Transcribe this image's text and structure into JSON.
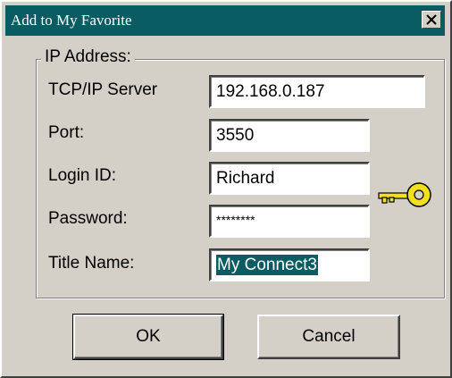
{
  "window": {
    "title": "Add to My Favorite",
    "close_glyph": "×",
    "titlebar_color": "#0a5c63"
  },
  "group": {
    "legend": "IP Address:"
  },
  "fields": {
    "server": {
      "label": "TCP/IP Server",
      "value": "192.168.0.187"
    },
    "port": {
      "label": "Port:",
      "value": "3550"
    },
    "login": {
      "label": "Login ID:",
      "value": "Richard"
    },
    "password": {
      "label": "Password:",
      "value": "********"
    },
    "title": {
      "label": "Title Name:",
      "value": "My Connect3"
    }
  },
  "icons": {
    "key": "key-icon"
  },
  "buttons": {
    "ok": "OK",
    "cancel": "Cancel"
  }
}
